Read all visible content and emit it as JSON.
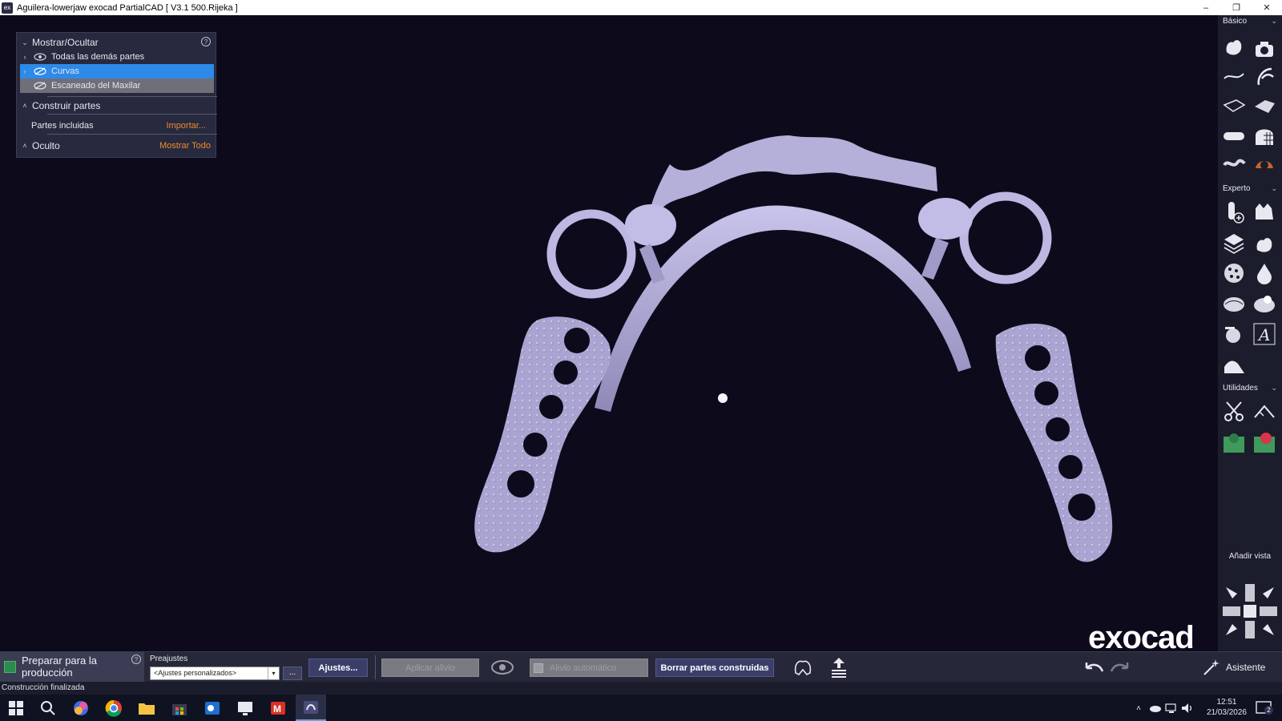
{
  "window": {
    "title": "Aguilera-lowerjaw exocad PartialCAD [ V3.1 500.Rijeka ]",
    "minimize": "–",
    "restore": "❐",
    "close": "✕"
  },
  "left_panel": {
    "header": "Mostrar/Ocultar",
    "items": [
      {
        "label": "Todas las demás partes"
      },
      {
        "label": "Curvas"
      },
      {
        "label": "Escaneado del Maxilar"
      }
    ],
    "build_section": "Construir partes",
    "included_parts": "Partes incluidas",
    "import_link": "Importar...",
    "hidden_section": "Oculto",
    "show_all_link": "Mostrar Todo"
  },
  "right_toolbar": {
    "sections": [
      "Básico",
      "Experto",
      "Utilidades"
    ],
    "add_view": "Añadir vista",
    "tools_basic": [
      "tooth-arch-icon",
      "camera-icon",
      "curve-icon",
      "clasp-icon",
      "plate-icon",
      "mesh-plate-icon",
      "bar-icon",
      "retention-icon",
      "wax-icon",
      "finish-line-icon"
    ],
    "tools_expert": [
      "add-attachment-icon",
      "crown-icon",
      "layers-icon",
      "tooth-plus-icon",
      "texture-icon",
      "drop-icon",
      "sphere-a-icon",
      "sphere-b-icon",
      "sculpt-icon",
      "text-icon",
      "surface-icon"
    ],
    "tools_utils": [
      "cut-icon",
      "measure-icon",
      "color-map-green-icon",
      "color-map-red-icon"
    ]
  },
  "bottom_toolbar": {
    "prepare_label": "Preparar para la producción",
    "presets_label": "Preajustes",
    "preset_value": "<Ajustes personalizados>",
    "dots_label": "...",
    "settings_button": "Ajustes...",
    "apply_relief_button": "Aplicar alivio",
    "auto_relief_label": "Alivio automático",
    "delete_parts_button": "Borrar partes construidas",
    "assistant_label": "Asistente"
  },
  "status": {
    "text": "Construcción finalizada"
  },
  "logo_text": "exocad",
  "taskbar": {
    "time": "12:51",
    "date": "21/03/2026",
    "notification_count": "2",
    "apps": [
      "windows-start-icon",
      "search-icon",
      "copilot-icon",
      "chrome-icon",
      "file-explorer-icon",
      "store-icon",
      "outlook-icon",
      "remote-desktop-icon",
      "gmail-icon",
      "exocad-icon"
    ]
  },
  "colors": {
    "background": "#0d0a1c",
    "panel": "#272a3e",
    "selected": "#2d8ae8",
    "accent_orange": "#f08a2c",
    "model": "#b8b4dc"
  }
}
